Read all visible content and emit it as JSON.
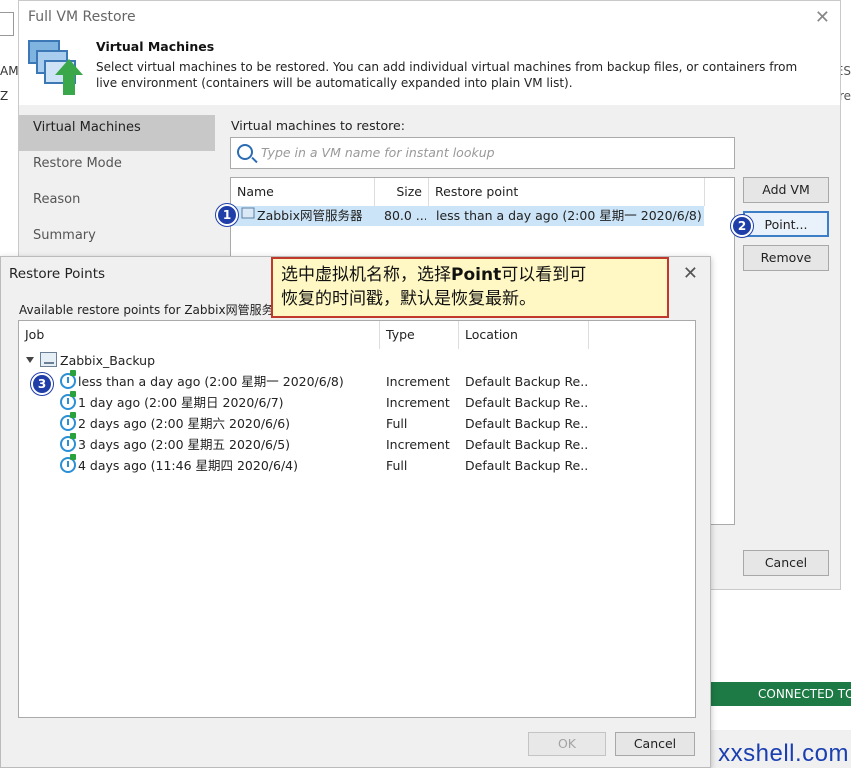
{
  "background": {
    "left_texts": [
      "AM",
      "Z"
    ],
    "right_texts": [
      "ES",
      "re"
    ],
    "status": "CONNECTED TO",
    "watermark": "xxshell.com"
  },
  "wizard": {
    "title": "Full VM Restore",
    "close": "✕",
    "header_title": "Virtual Machines",
    "header_desc": "Select virtual machines to be restored. You can add individual virtual machines from backup files, or containers from live environment (containers will be automatically expanded into plain VM list).",
    "steps": [
      "Virtual Machines",
      "Restore Mode",
      "Reason",
      "Summary"
    ],
    "vm_label": "Virtual machines to restore:",
    "search_placeholder": "Type in a VM name for instant lookup",
    "columns": [
      "Name",
      "Size",
      "Restore point"
    ],
    "row": {
      "name": "Zabbix网管服务器",
      "size": "80.0 ...",
      "restore_point": "less than a day ago (2:00 星期一 2020/6/8)"
    },
    "buttons": {
      "add_vm": "Add VM",
      "point": "Point...",
      "remove": "Remove",
      "cancel": "Cancel"
    }
  },
  "restore_points": {
    "title": "Restore Points",
    "close": "✕",
    "available": "Available restore points for Zabbix网管服务器",
    "columns": [
      "Job",
      "Type",
      "Location"
    ],
    "job": "Zabbix_Backup",
    "rows": [
      {
        "job": "less than a day ago (2:00 星期一 2020/6/8)",
        "type": "Increment",
        "location": "Default Backup Re..."
      },
      {
        "job": "1 day ago (2:00 星期日 2020/6/7)",
        "type": "Increment",
        "location": "Default Backup Re..."
      },
      {
        "job": "2 days ago (2:00 星期六 2020/6/6)",
        "type": "Full",
        "location": "Default Backup Re..."
      },
      {
        "job": "3 days ago (2:00 星期五 2020/6/5)",
        "type": "Increment",
        "location": "Default Backup Re..."
      },
      {
        "job": "4 days ago (11:46 星期四 2020/6/4)",
        "type": "Full",
        "location": "Default Backup Re..."
      }
    ],
    "ok": "OK",
    "cancel": "Cancel"
  },
  "annotation": {
    "line1_a": "选中虚拟机名称，选择",
    "line1_b": "Point",
    "line1_c": "可以看到可",
    "line2": "恢复的时间戳，默认是恢复最新。",
    "badges": [
      "1",
      "2",
      "3"
    ]
  }
}
